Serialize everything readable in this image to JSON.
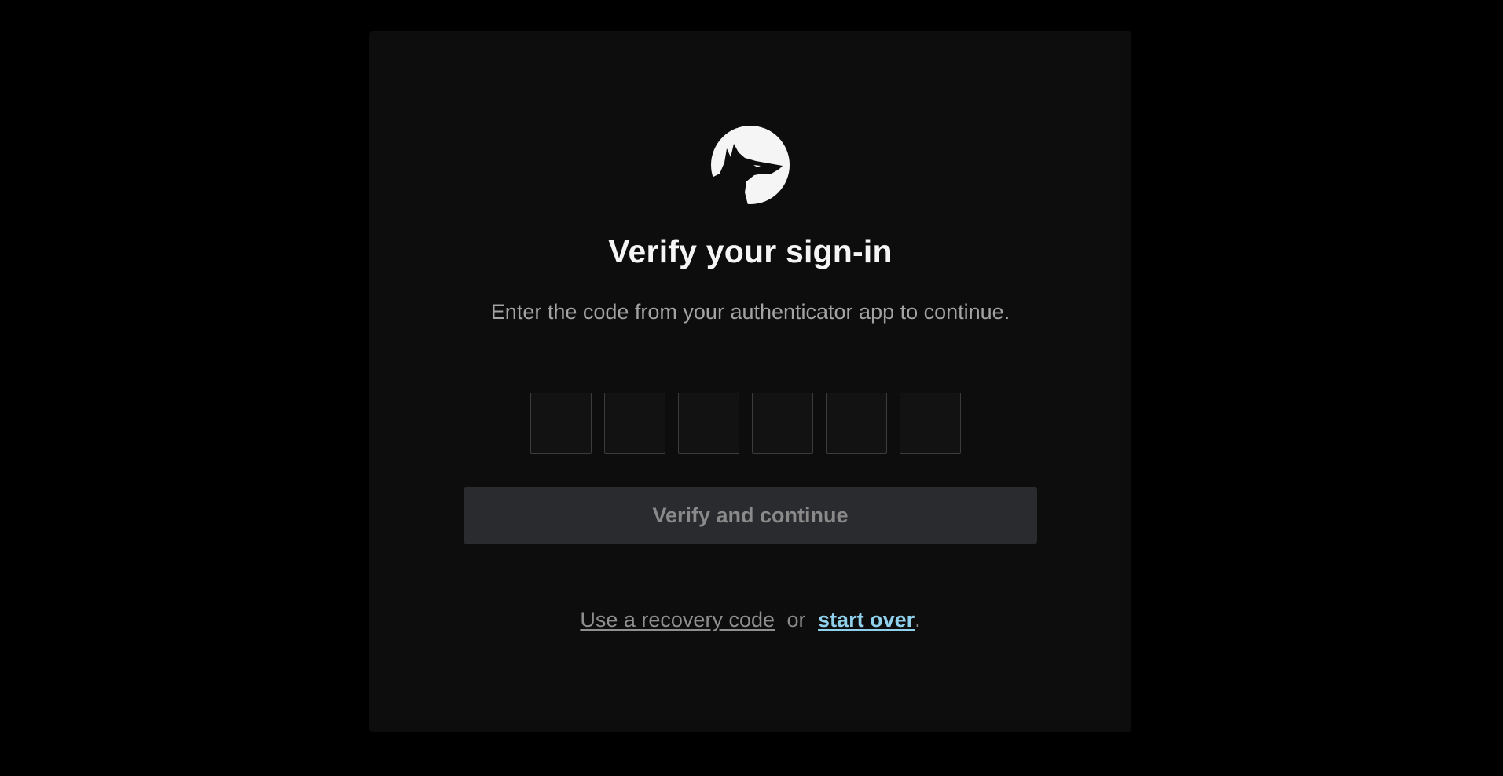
{
  "logo": {
    "icon": "wolf-moon-logo-icon",
    "moon_color": "#f5f5f5",
    "wolf_color": "#0d0d0d"
  },
  "heading": {
    "title": "Verify your sign-in",
    "subtitle": "Enter the code from your authenticator app to continue."
  },
  "code": {
    "digits": [
      "",
      "",
      "",
      "",
      "",
      ""
    ]
  },
  "verify_button": {
    "label": "Verify and continue",
    "background": "#2a2b2e",
    "text_color": "#8a8a8a"
  },
  "footer": {
    "recovery_link": "Use a recovery code",
    "separator": "or",
    "start_over_link": "start over",
    "period": ".",
    "accent": "#8fd0ec"
  }
}
